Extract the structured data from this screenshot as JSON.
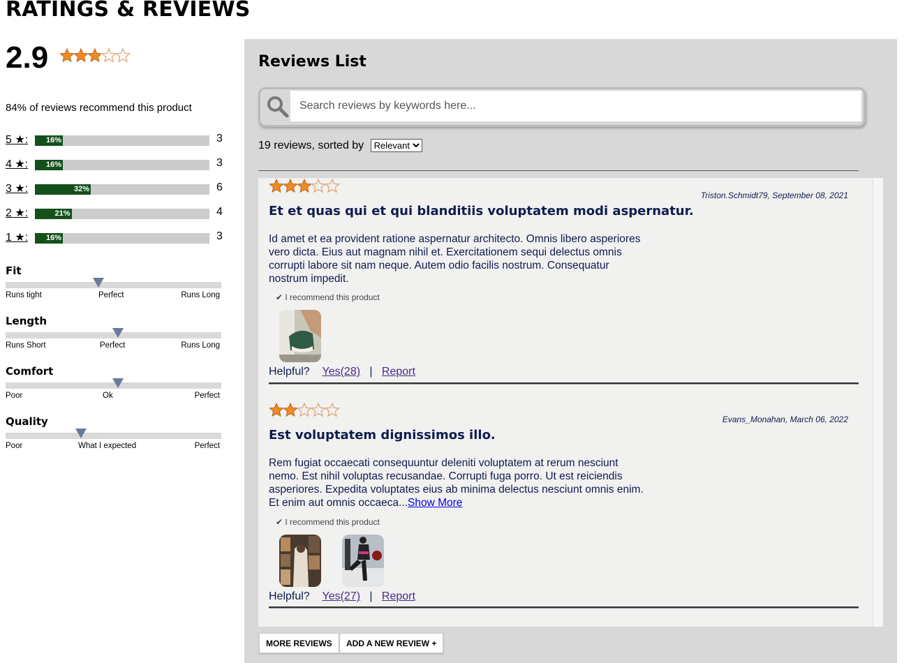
{
  "page_title": "RATINGS & REVIEWS",
  "summary": {
    "average": "2.9",
    "average_rating": 2.9,
    "recommend_text": "84% of reviews recommend this product"
  },
  "breakdown": [
    {
      "label": "5 ★:",
      "percent_text": "16%",
      "percent": 16,
      "count": "3"
    },
    {
      "label": "4 ★:",
      "percent_text": "16%",
      "percent": 16,
      "count": "3"
    },
    {
      "label": "3 ★:",
      "percent_text": "32%",
      "percent": 32,
      "count": "6"
    },
    {
      "label": "2 ★:",
      "percent_text": "21%",
      "percent": 21,
      "count": "4"
    },
    {
      "label": "1 ★:",
      "percent_text": "16%",
      "percent": 16,
      "count": "3"
    }
  ],
  "characteristics": [
    {
      "name": "Fit",
      "level": 0.43,
      "labels": [
        "Runs tight",
        "Perfect",
        "Runs Long"
      ]
    },
    {
      "name": "Length",
      "level": 0.52,
      "labels": [
        "Runs Short",
        "Perfect",
        "Runs Long"
      ]
    },
    {
      "name": "Comfort",
      "level": 0.52,
      "labels": [
        "Poor",
        "Ok",
        "Perfect"
      ]
    },
    {
      "name": "Quality",
      "level": 0.35,
      "labels": [
        "Poor",
        "What I expected",
        "Perfect"
      ]
    }
  ],
  "reviews_list": {
    "title": "Reviews List",
    "search_placeholder": "Search reviews by keywords here...",
    "count_text": "19 reviews, sorted by",
    "sort_selected": "Relevant"
  },
  "reviews": [
    {
      "rating": 3,
      "author_date": "Triston.Schmidt79, September 08, 2021",
      "title": "Et et quas qui et qui blanditiis voluptatem modi aspernatur.",
      "body": "Id amet et ea provident ratione aspernatur architecto. Omnis libero asperiores vero dicta. Eius aut magnam nihil et. Exercitationem sequi delectus omnis corrupti labore sit nam neque. Autem odio facilis nostrum. Consequatur nostrum impedit.",
      "show_more": "",
      "recommend": "✔ I recommend this product",
      "helpful_label": "Helpful?",
      "yes_label": "Yes(28)",
      "divider": "|",
      "report_label": "Report"
    },
    {
      "rating": 2,
      "author_date": "Evans_Monahan, March 06, 2022",
      "title": "Est voluptatem dignissimos illo.",
      "body": "Rem fugiat occaecati consequuntur deleniti voluptatem at rerum nesciunt nemo. Est nihil voluptas recusandae. Corrupti fuga porro. Ut est reiciendis asperiores. Expedita voluptates eius ab minima delectus nesciunt omnis enim. Et enim aut omnis occaeca...",
      "show_more": "Show More",
      "recommend": "✔ I recommend this product",
      "helpful_label": "Helpful?",
      "yes_label": "Yes(27)",
      "divider": "|",
      "report_label": "Report"
    }
  ],
  "buttons": {
    "more_reviews": "MORE REVIEWS",
    "add_review": "ADD A NEW REVIEW +"
  },
  "colors": {
    "star_fill": "#f08a24",
    "star_outline": "#e0a070",
    "bar_fill": "#14501a",
    "bar_track": "#cccccc",
    "panel_bg": "#d8d8d8",
    "review_bg": "#f1f1f0",
    "review_text": "#0f1c4d",
    "marker": "#6a7a99"
  }
}
